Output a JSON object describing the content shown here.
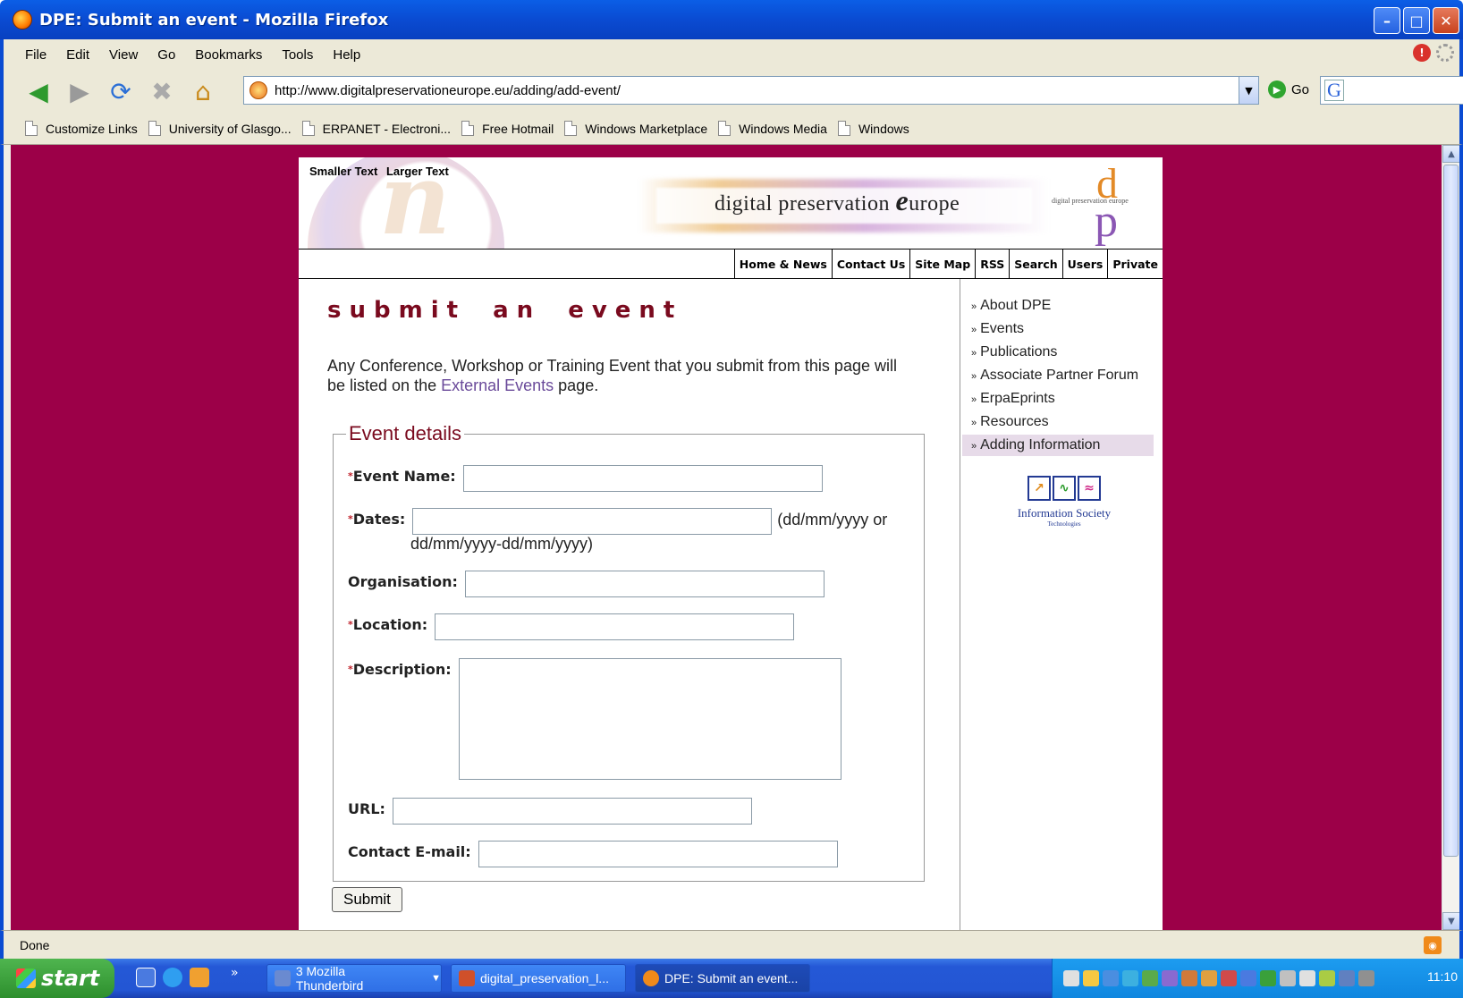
{
  "window": {
    "title": "DPE: Submit an event - Mozilla Firefox"
  },
  "menu": [
    "File",
    "Edit",
    "View",
    "Go",
    "Bookmarks",
    "Tools",
    "Help"
  ],
  "nav": {
    "url": "http://www.digitalpreservationeurope.eu/adding/add-event/",
    "go_label": "Go"
  },
  "bookmarks": [
    "Customize Links",
    "University of Glasgo...",
    "ERPANET - Electroni...",
    "Free Hotmail",
    "Windows Marketplace",
    "Windows Media",
    "Windows"
  ],
  "site": {
    "text_size": {
      "smaller": "Smaller Text",
      "larger": "Larger Text"
    },
    "logo": {
      "text_main": "digital preservation ",
      "text_e": "e",
      "text_rest": "urope",
      "mini_d": "d",
      "mini_p": "p",
      "mini_text": "digital preservation europe"
    },
    "topnav": [
      "Home & News",
      "Contact Us",
      "Site Map",
      "RSS",
      "Search",
      "Users",
      "Private"
    ]
  },
  "main": {
    "heading": "submit an event",
    "intro_before": "Any Conference, Workshop or Training Event that you submit from this page will be listed on the ",
    "intro_link": "External Events",
    "intro_after": " page.",
    "form": {
      "legend": "Event details",
      "required_mark": "*",
      "event_name_label": "Event Name:",
      "dates_label": "Dates:",
      "dates_hint_1": "(dd/mm/yyyy or",
      "dates_hint_2": "dd/mm/yyyy-dd/mm/yyyy)",
      "organisation_label": "Organisation:",
      "location_label": "Location:",
      "description_label": "Description:",
      "url_label": "URL:",
      "email_label": "Contact E-mail:",
      "submit_label": "Submit"
    }
  },
  "sidebar": {
    "items": [
      {
        "label": "About DPE",
        "active": false
      },
      {
        "label": "Events",
        "active": false
      },
      {
        "label": "Publications",
        "active": false
      },
      {
        "label": "Associate Partner Forum",
        "active": false
      },
      {
        "label": "ErpaEprints",
        "active": false
      },
      {
        "label": "Resources",
        "active": false
      },
      {
        "label": "Adding Information",
        "active": true
      }
    ],
    "ist": {
      "name": "Information Society",
      "sub": "Technologies"
    }
  },
  "status": {
    "text": "Done"
  },
  "taskbar": {
    "start_label": "start",
    "tasks": [
      "3 Mozilla Thunderbird",
      "digital_preservation_l...",
      "DPE: Submit an event..."
    ],
    "clock": "11:10"
  },
  "colors": {
    "site_background": "#9c0048",
    "heading": "#7a0a1e",
    "link": "#6a4a9a",
    "active_sidebar": "#e7dbe9"
  }
}
